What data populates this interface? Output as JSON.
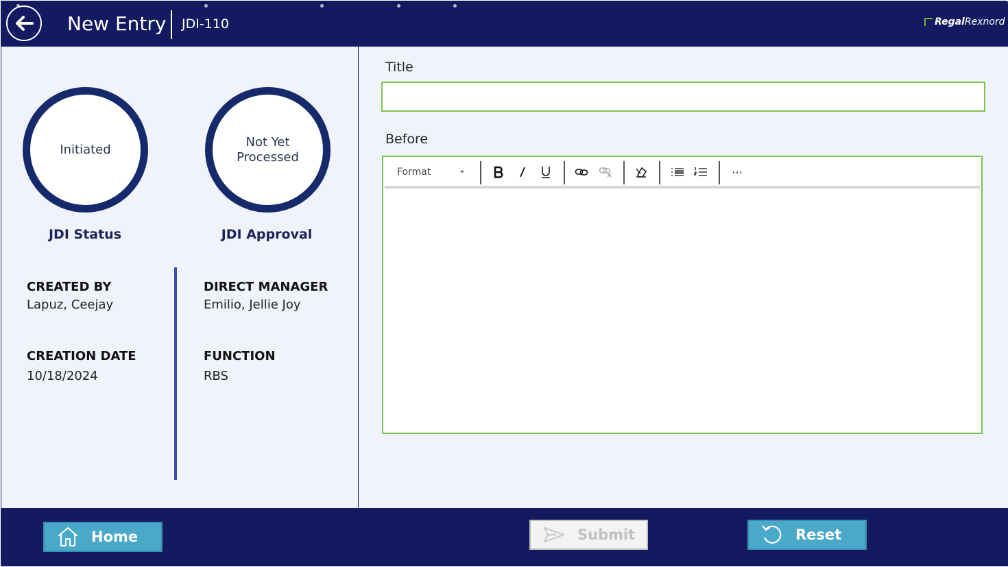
{
  "header": {
    "title": "New Entry",
    "record_id": "JDI-110",
    "brand": {
      "part1": "Regal",
      "part2": "Rexnord"
    }
  },
  "status": {
    "jdi_status": {
      "value": "Initiated",
      "label": "JDI Status"
    },
    "jdi_approval": {
      "value_line1": "Not Yet",
      "value_line2": "Processed",
      "label": "JDI Approval"
    }
  },
  "details": {
    "created_by": {
      "label": "CREATED BY",
      "value": "Lapuz, Ceejay"
    },
    "creation_date": {
      "label": "CREATION DATE",
      "value": "10/18/2024"
    },
    "direct_manager": {
      "label": "DIRECT MANAGER",
      "value": "Emilio, Jellie Joy"
    },
    "function": {
      "label": "FUNCTION",
      "value": "RBS"
    }
  },
  "form": {
    "title_label": "Title",
    "title_value": "",
    "before_label": "Before",
    "toolbar": {
      "format_label": "Format",
      "more_label": "···"
    }
  },
  "footer": {
    "home_label": "Home",
    "submit_label": "Submit",
    "reset_label": "Reset"
  },
  "colors": {
    "navy": "#131a60",
    "ring": "#15296b",
    "accent_button": "#4aa8c8",
    "input_border": "#7cc356",
    "panel_bg": "#f0f3f9",
    "divider": "#3650a8"
  }
}
